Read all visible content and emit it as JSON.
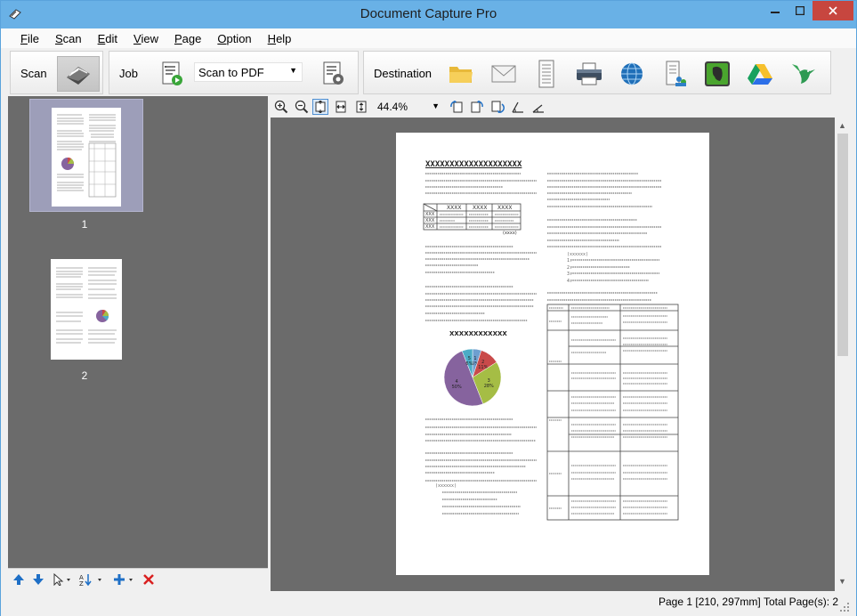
{
  "window": {
    "title": "Document Capture Pro"
  },
  "menu": {
    "items": [
      {
        "label": "File",
        "u": "F",
        "rest": "ile"
      },
      {
        "label": "Scan",
        "u": "S",
        "rest": "can"
      },
      {
        "label": "Edit",
        "u": "E",
        "rest": "dit"
      },
      {
        "label": "View",
        "u": "V",
        "rest": "iew"
      },
      {
        "label": "Page",
        "u": "P",
        "rest": "age"
      },
      {
        "label": "Option",
        "u": "O",
        "rest": "ption"
      },
      {
        "label": "Help",
        "u": "H",
        "rest": "elp"
      }
    ]
  },
  "toolbar": {
    "scan_label": "Scan",
    "job_label": "Job",
    "job_selected": "Scan to PDF",
    "destination_label": "Destination",
    "destinations": [
      "folder-icon",
      "email-icon",
      "print-to-file-icon",
      "printer-icon",
      "web-icon",
      "document-server-icon",
      "evernote-icon",
      "google-drive-icon",
      "hummingbird-icon"
    ]
  },
  "viewer": {
    "zoom": "44.4%"
  },
  "thumbnails": [
    {
      "number": "1",
      "selected": true
    },
    {
      "number": "2",
      "selected": false
    }
  ],
  "document": {
    "heading": "XXXXXXXXXXXXXXXXXXXX",
    "pie_title": "XXXXXXXXXXXX",
    "pie": [
      {
        "label": "1",
        "value": 5,
        "color": "#6e9fd0"
      },
      {
        "label": "2",
        "value": 11,
        "color": "#c94a4a"
      },
      {
        "label": "3",
        "value": 28,
        "color": "#a5bd45"
      },
      {
        "label": "4",
        "value": 50,
        "color": "#86639e"
      },
      {
        "label": "5",
        "value": 6,
        "color": "#4bacc6"
      }
    ],
    "table_head": [
      "XXXX",
      "XXXX",
      "XXXX"
    ],
    "table_note": "(xxxx)"
  },
  "status": {
    "page": "Page 1 [210, 297mm]",
    "total": "Total Page(s): 2"
  }
}
